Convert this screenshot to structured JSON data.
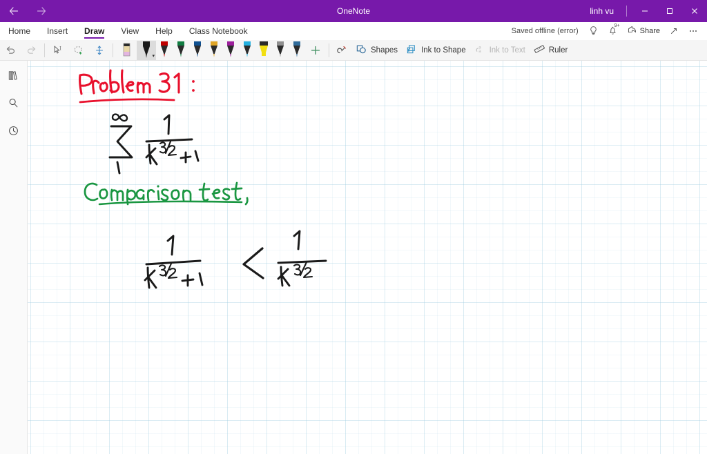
{
  "titlebar": {
    "app_title": "OneNote",
    "account_name": "linh vu",
    "back_icon": "arrow-left-icon",
    "forward_icon": "arrow-right-icon",
    "minimize_label": "–",
    "maximize_label": "❐",
    "close_label": "✕",
    "accent_color": "#7719aa"
  },
  "ribbon": {
    "tabs": [
      {
        "label": "Home",
        "active": false
      },
      {
        "label": "Insert",
        "active": false
      },
      {
        "label": "Draw",
        "active": true
      },
      {
        "label": "View",
        "active": false
      },
      {
        "label": "Help",
        "active": false
      },
      {
        "label": "Class Notebook",
        "active": false
      }
    ],
    "save_status": "Saved offline (error)",
    "lightbulb_icon": "lightbulb-icon",
    "bell_icon": "bell-icon",
    "bell_badge": "9+",
    "share_label": "Share",
    "share_icon": "share-icon",
    "expand_icon": "diagonal-arrow-icon",
    "more_icon": "ellipsis-icon"
  },
  "toolbar": {
    "undo_icon": "undo-icon",
    "redo_icon": "redo-icon",
    "select_icon": "type-select-icon",
    "lasso_icon": "lasso-select-icon",
    "pan_icon": "pan-icon",
    "eraser_icon": "eraser-icon",
    "add_pen_icon": "add-pen-icon",
    "pen_settings_icon": "pen-settings-icon",
    "pens": [
      {
        "name": "pen-black",
        "color": "#1a1a1a",
        "tip": "pen",
        "selected": true
      },
      {
        "name": "pen-red",
        "color": "#c00000",
        "tip": "pen",
        "selected": false
      },
      {
        "name": "pen-green",
        "color": "#107c41",
        "tip": "pen",
        "selected": false
      },
      {
        "name": "pen-blue",
        "color": "#0e4f8f",
        "tip": "pen",
        "selected": false
      },
      {
        "name": "pen-gold",
        "color": "#e0a526",
        "tip": "pen",
        "selected": false
      },
      {
        "name": "pen-magenta",
        "color": "#9c1f9c",
        "tip": "pen",
        "selected": false
      },
      {
        "name": "pen-cyan",
        "color": "#23b0e0",
        "tip": "pen",
        "selected": false
      },
      {
        "name": "highlighter-yellow",
        "color": "#f2df11",
        "tip": "highlighter",
        "selected": false
      },
      {
        "name": "pen-gray",
        "color": "#8f8f8f",
        "tip": "pen",
        "selected": false
      },
      {
        "name": "pen-steel-blue",
        "color": "#2f6b9a",
        "tip": "pen",
        "selected": false
      }
    ],
    "shapes_label": "Shapes",
    "shapes_icon": "shapes-icon",
    "ink_to_shape_label": "Ink to Shape",
    "ink_to_shape_icon": "ink-to-shape-icon",
    "ink_to_text_label": "Ink to Text",
    "ink_to_text_icon": "ink-to-text-icon",
    "ink_to_text_disabled": true,
    "ruler_label": "Ruler",
    "ruler_icon": "ruler-icon"
  },
  "sidebar": {
    "items": [
      {
        "name": "notebooks-icon",
        "label": "Notebooks"
      },
      {
        "name": "search-icon",
        "label": "Search"
      },
      {
        "name": "recent-icon",
        "label": "Recent Notes"
      }
    ]
  },
  "canvas": {
    "ink_colors": {
      "red": "#e8112d",
      "black": "#1a1a1a",
      "green": "#1a9641"
    },
    "strokes": [
      {
        "name": "heading-problem-31",
        "color": "red",
        "text": "Problem 31 :"
      },
      {
        "name": "heading-underline",
        "color": "red",
        "text": ""
      },
      {
        "name": "series-expression",
        "color": "black",
        "text": "∑ (1 to ∞) 1 / (k^3/2 + 1)"
      },
      {
        "name": "comparison-test-label",
        "color": "green",
        "text": "Comparison test,"
      },
      {
        "name": "comparison-test-underline",
        "color": "green",
        "text": ""
      },
      {
        "name": "inequality-expression",
        "color": "black",
        "text": "1 / (k^3/2 + 1)  <  1 / k^3/2"
      }
    ],
    "text": {
      "problem_title": "Problem 31 :",
      "sum_upper": "∞",
      "sum_lower": "1",
      "sum_sigma": "∑",
      "numerator": "1",
      "denominator_base": "k",
      "denominator_exp": "3/2",
      "denominator_tail": "+1",
      "comparison_label": "Comparison test,",
      "lhs_num": "1",
      "lhs_base": "k",
      "lhs_exp": "3/2",
      "lhs_tail": "+1",
      "relation": "<",
      "rhs_num": "1",
      "rhs_base": "k",
      "rhs_exp": "3/2"
    }
  }
}
